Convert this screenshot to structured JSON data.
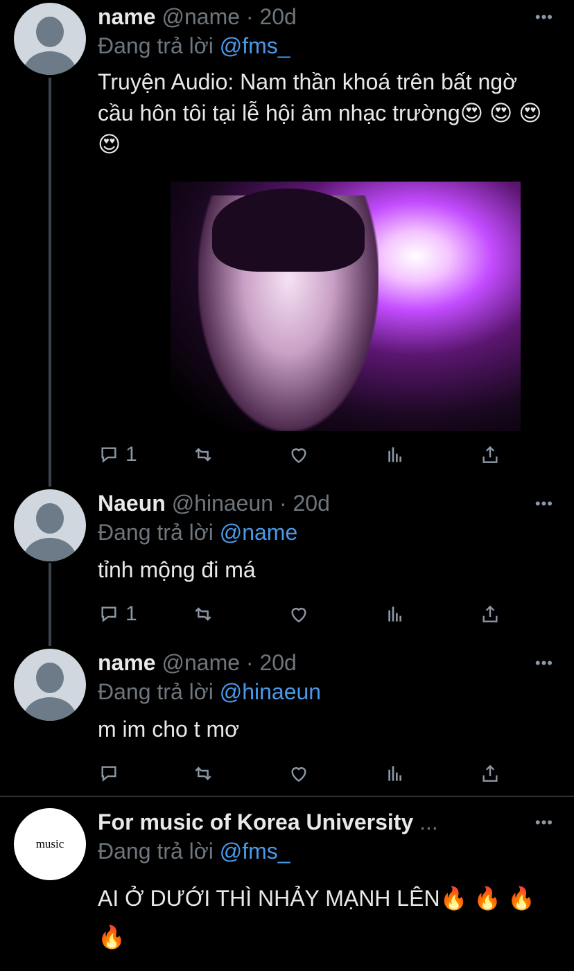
{
  "tweets": [
    {
      "name": "name",
      "handle": "@name",
      "time": "· 20d",
      "reply_prefix": "Đang trả lời",
      "reply_to": "@fms_",
      "text": "Truyện Audio: Nam thần khoá trên bất ngờ cầu hôn tôi tại lễ hội âm nhạc trường😍 😍 😍 😍",
      "reply_count": "1",
      "retweet_count": "",
      "like_count": "",
      "has_media": true
    },
    {
      "name": "Naeun",
      "handle": "@hinaeun",
      "time": "· 20d",
      "reply_prefix": "Đang trả lời",
      "reply_to": "@name",
      "text": "tỉnh mộng đi má",
      "reply_count": "1",
      "retweet_count": "",
      "like_count": ""
    },
    {
      "name": "name",
      "handle": "@name",
      "time": "· 20d",
      "reply_prefix": "Đang trả lời",
      "reply_to": "@hinaeun",
      "text": "m im cho t mơ",
      "reply_count": "",
      "retweet_count": "",
      "like_count": ""
    },
    {
      "name": "For music of Korea University",
      "handle": "...",
      "time": "",
      "reply_prefix": "Đang trả lời",
      "reply_to": "@fms_",
      "text": "AI Ở DƯỚI THÌ NHẢY MẠNH LÊN🔥 🔥 🔥 🔥",
      "avatar_text": "music"
    }
  ],
  "more_label": "•••",
  "icons": [
    "reply-icon",
    "retweet-icon",
    "like-icon",
    "analytics-icon",
    "share-icon",
    "more-icon"
  ],
  "colors": {
    "background": "#000000",
    "mention": "#4a99e9",
    "secondary": "#6e767d",
    "avatar": "#d0d7de"
  }
}
